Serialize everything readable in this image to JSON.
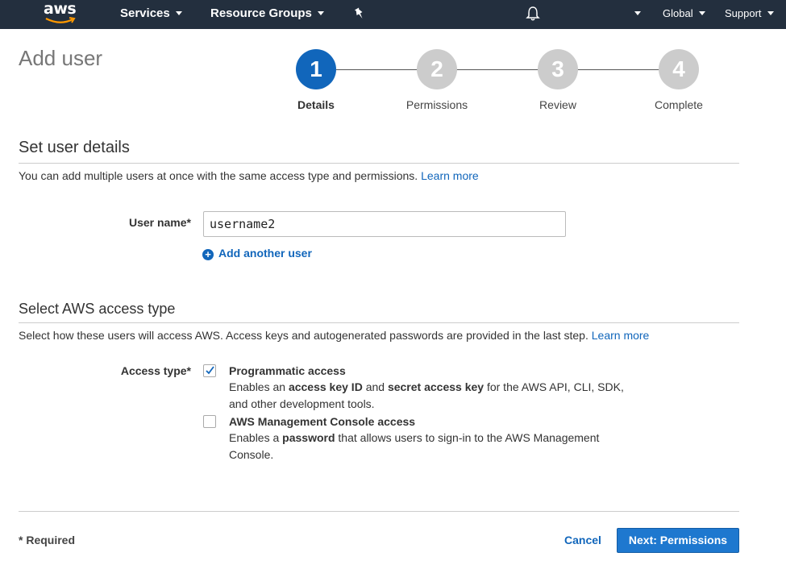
{
  "nav": {
    "logo_text": "aws",
    "services": "Services",
    "resource_groups": "Resource Groups",
    "region": "Global",
    "support": "Support"
  },
  "page": {
    "title": "Add user"
  },
  "stepper": {
    "current_step": 1,
    "steps": [
      {
        "number": "1",
        "label": "Details"
      },
      {
        "number": "2",
        "label": "Permissions"
      },
      {
        "number": "3",
        "label": "Review"
      },
      {
        "number": "4",
        "label": "Complete"
      }
    ]
  },
  "user_details": {
    "title": "Set user details",
    "description": "You can add multiple users at once with the same access type and permissions.",
    "learn_more": "Learn more",
    "username_label": "User name*",
    "username_value": "username2",
    "add_another": "Add another user"
  },
  "access_type": {
    "title": "Select AWS access type",
    "description": "Select how these users will access AWS. Access keys and autogenerated passwords are provided in the last step.",
    "learn_more": "Learn more",
    "label": "Access type*",
    "options": [
      {
        "title": "Programmatic access",
        "checked": true,
        "desc_parts": [
          "Enables an ",
          "access key ID",
          " and ",
          "secret access key",
          " for the AWS API, CLI, SDK, and other development tools."
        ]
      },
      {
        "title": "AWS Management Console access",
        "checked": false,
        "desc_parts": [
          "Enables a ",
          "password",
          " that allows users to sign-in to the AWS Management Console."
        ]
      }
    ]
  },
  "footer": {
    "required": "* Required",
    "cancel": "Cancel",
    "next": "Next: Permissions"
  },
  "colors": {
    "nav_bg": "#232f3e",
    "accent": "#1166bb",
    "step_inactive": "#cccccc",
    "primary_button": "#1e78cf"
  }
}
